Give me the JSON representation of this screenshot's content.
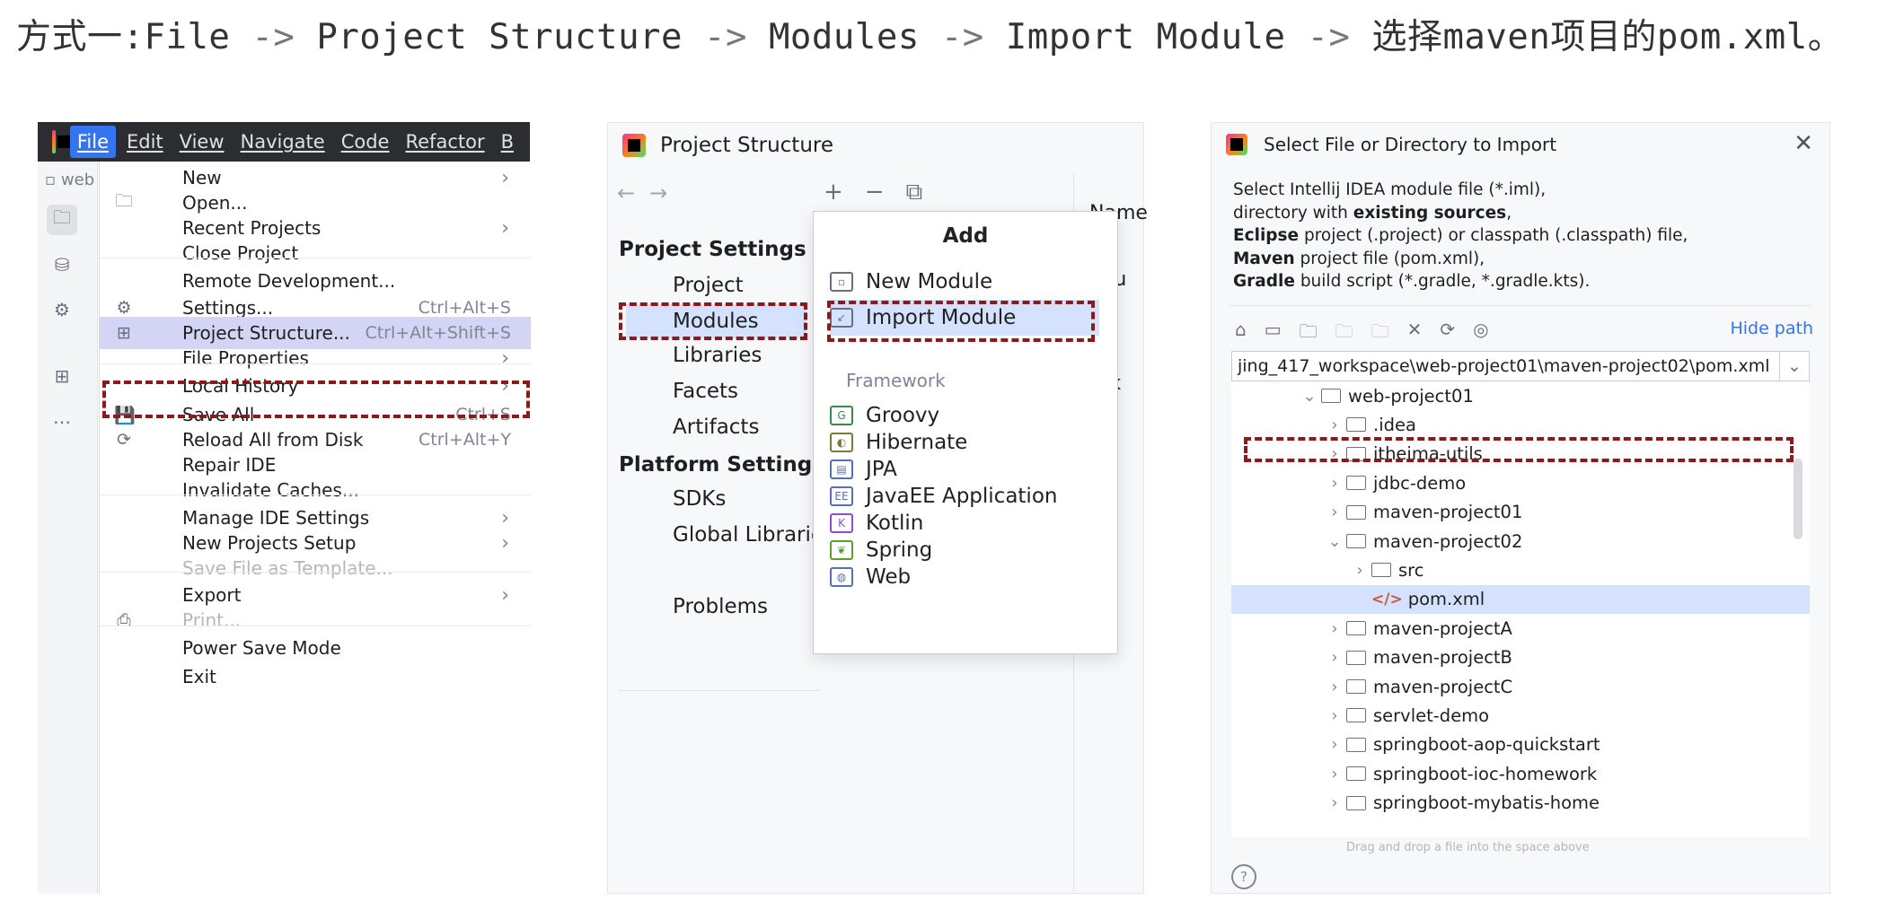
{
  "heading": {
    "prefix": "方式一:File",
    "arrow": "->",
    "step2": "Project Structure",
    "step3": "Modules",
    "step4": "Import Module",
    "step5": "选择maven项目的pom.xml。"
  },
  "file_menu": {
    "menubar": [
      "File",
      "Edit",
      "View",
      "Navigate",
      "Code",
      "Refactor",
      "B"
    ],
    "project_tab": "web",
    "items": [
      {
        "label": "New",
        "shortcut": "",
        "submenu": true,
        "icon": "",
        "disabled": false
      },
      {
        "label": "Open...",
        "shortcut": "",
        "submenu": false,
        "icon": "folder-icon",
        "disabled": false
      },
      {
        "label": "Recent Projects",
        "shortcut": "",
        "submenu": true,
        "icon": "",
        "disabled": false
      },
      {
        "label": "Close Project",
        "shortcut": "",
        "submenu": false,
        "icon": "",
        "disabled": false
      },
      {
        "label": "Remote Development...",
        "shortcut": "",
        "submenu": false,
        "icon": "",
        "disabled": false
      },
      {
        "label": "Settings...",
        "shortcut": "Ctrl+Alt+S",
        "submenu": false,
        "icon": "gear-icon",
        "disabled": false
      },
      {
        "label": "Project Structure...",
        "shortcut": "Ctrl+Alt+Shift+S",
        "submenu": false,
        "icon": "project-structure-icon",
        "disabled": false
      },
      {
        "label": "File Properties",
        "shortcut": "",
        "submenu": true,
        "icon": "",
        "disabled": false
      },
      {
        "label": "Local History",
        "shortcut": "",
        "submenu": true,
        "icon": "",
        "disabled": false
      },
      {
        "label": "Save All",
        "shortcut": "Ctrl+S",
        "submenu": false,
        "icon": "save-icon",
        "disabled": false
      },
      {
        "label": "Reload All from Disk",
        "shortcut": "Ctrl+Alt+Y",
        "submenu": false,
        "icon": "reload-icon",
        "disabled": false
      },
      {
        "label": "Repair IDE",
        "shortcut": "",
        "submenu": false,
        "icon": "",
        "disabled": false
      },
      {
        "label": "Invalidate Caches...",
        "shortcut": "",
        "submenu": false,
        "icon": "",
        "disabled": false
      },
      {
        "label": "Manage IDE Settings",
        "shortcut": "",
        "submenu": true,
        "icon": "",
        "disabled": false
      },
      {
        "label": "New Projects Setup",
        "shortcut": "",
        "submenu": true,
        "icon": "",
        "disabled": false
      },
      {
        "label": "Save File as Template...",
        "shortcut": "",
        "submenu": false,
        "icon": "",
        "disabled": true
      },
      {
        "label": "Export",
        "shortcut": "",
        "submenu": true,
        "icon": "",
        "disabled": false
      },
      {
        "label": "Print...",
        "shortcut": "",
        "submenu": false,
        "icon": "print-icon",
        "disabled": true
      },
      {
        "label": "Power Save Mode",
        "shortcut": "",
        "submenu": false,
        "icon": "",
        "disabled": false
      },
      {
        "label": "Exit",
        "shortcut": "",
        "submenu": false,
        "icon": "",
        "disabled": false
      }
    ]
  },
  "project_structure": {
    "title": "Project Structure",
    "project_settings": "Project Settings",
    "project_items": [
      "Project",
      "Modules",
      "Libraries",
      "Facets",
      "Artifacts"
    ],
    "platform_settings": "Platform Settings",
    "platform_items": [
      "SDKs",
      "Global Librarie"
    ],
    "problems": "Problems",
    "ghost_text": [
      "Name",
      "Sou",
      "ng",
      "ark"
    ],
    "popup": {
      "title": "Add",
      "items": [
        "New Module",
        "Import Module"
      ],
      "framework_label": "Framework",
      "frameworks": [
        "Groovy",
        "Hibernate",
        "JPA",
        "JavaEE Application",
        "Kotlin",
        "Spring",
        "Web"
      ]
    }
  },
  "select_file": {
    "title": "Select File or Directory to Import",
    "desc": [
      {
        "pre": "Select Intellij IDEA module file (*.iml),",
        "bold": "",
        "post": ""
      },
      {
        "pre": "directory with ",
        "bold": "existing sources",
        "post": ","
      },
      {
        "pre": "",
        "bold": "Eclipse",
        "post": " project (.project) or classpath (.classpath) file,"
      },
      {
        "pre": "",
        "bold": "Maven",
        "post": " project file (pom.xml),"
      },
      {
        "pre": "",
        "bold": "Gradle",
        "post": " build script (*.gradle, *.gradle.kts)."
      }
    ],
    "hide_path": "Hide path",
    "path": "jing_417_workspace\\web-project01\\maven-project02\\pom.xml",
    "tree": [
      {
        "label": "web-project01",
        "depth": 0,
        "caret": "⌄",
        "type": "folder"
      },
      {
        "label": ".idea",
        "depth": 1,
        "caret": "›",
        "type": "folder"
      },
      {
        "label": "itheima-utils",
        "depth": 1,
        "caret": "›",
        "type": "folder"
      },
      {
        "label": "jdbc-demo",
        "depth": 1,
        "caret": "›",
        "type": "folder"
      },
      {
        "label": "maven-project01",
        "depth": 1,
        "caret": "›",
        "type": "folder"
      },
      {
        "label": "maven-project02",
        "depth": 1,
        "caret": "⌄",
        "type": "folder"
      },
      {
        "label": "src",
        "depth": 2,
        "caret": "›",
        "type": "folder"
      },
      {
        "label": "pom.xml",
        "depth": 2,
        "caret": "",
        "type": "xml"
      },
      {
        "label": "maven-projectA",
        "depth": 1,
        "caret": "›",
        "type": "folder"
      },
      {
        "label": "maven-projectB",
        "depth": 1,
        "caret": "›",
        "type": "folder"
      },
      {
        "label": "maven-projectC",
        "depth": 1,
        "caret": "›",
        "type": "folder"
      },
      {
        "label": "servlet-demo",
        "depth": 1,
        "caret": "›",
        "type": "folder"
      },
      {
        "label": "springboot-aop-quickstart",
        "depth": 1,
        "caret": "›",
        "type": "folder"
      },
      {
        "label": "springboot-ioc-homework",
        "depth": 1,
        "caret": "›",
        "type": "folder"
      },
      {
        "label": "springboot-mybatis-home",
        "depth": 1,
        "caret": "›",
        "type": "folder"
      }
    ],
    "drag_hint": "Drag and drop a file into the space above"
  },
  "colors": {
    "highlight_border": "#8b1a1a",
    "selection": "#d4e2ff",
    "menu_highlight": "#d4d5f4",
    "accent": "#3574f0"
  }
}
